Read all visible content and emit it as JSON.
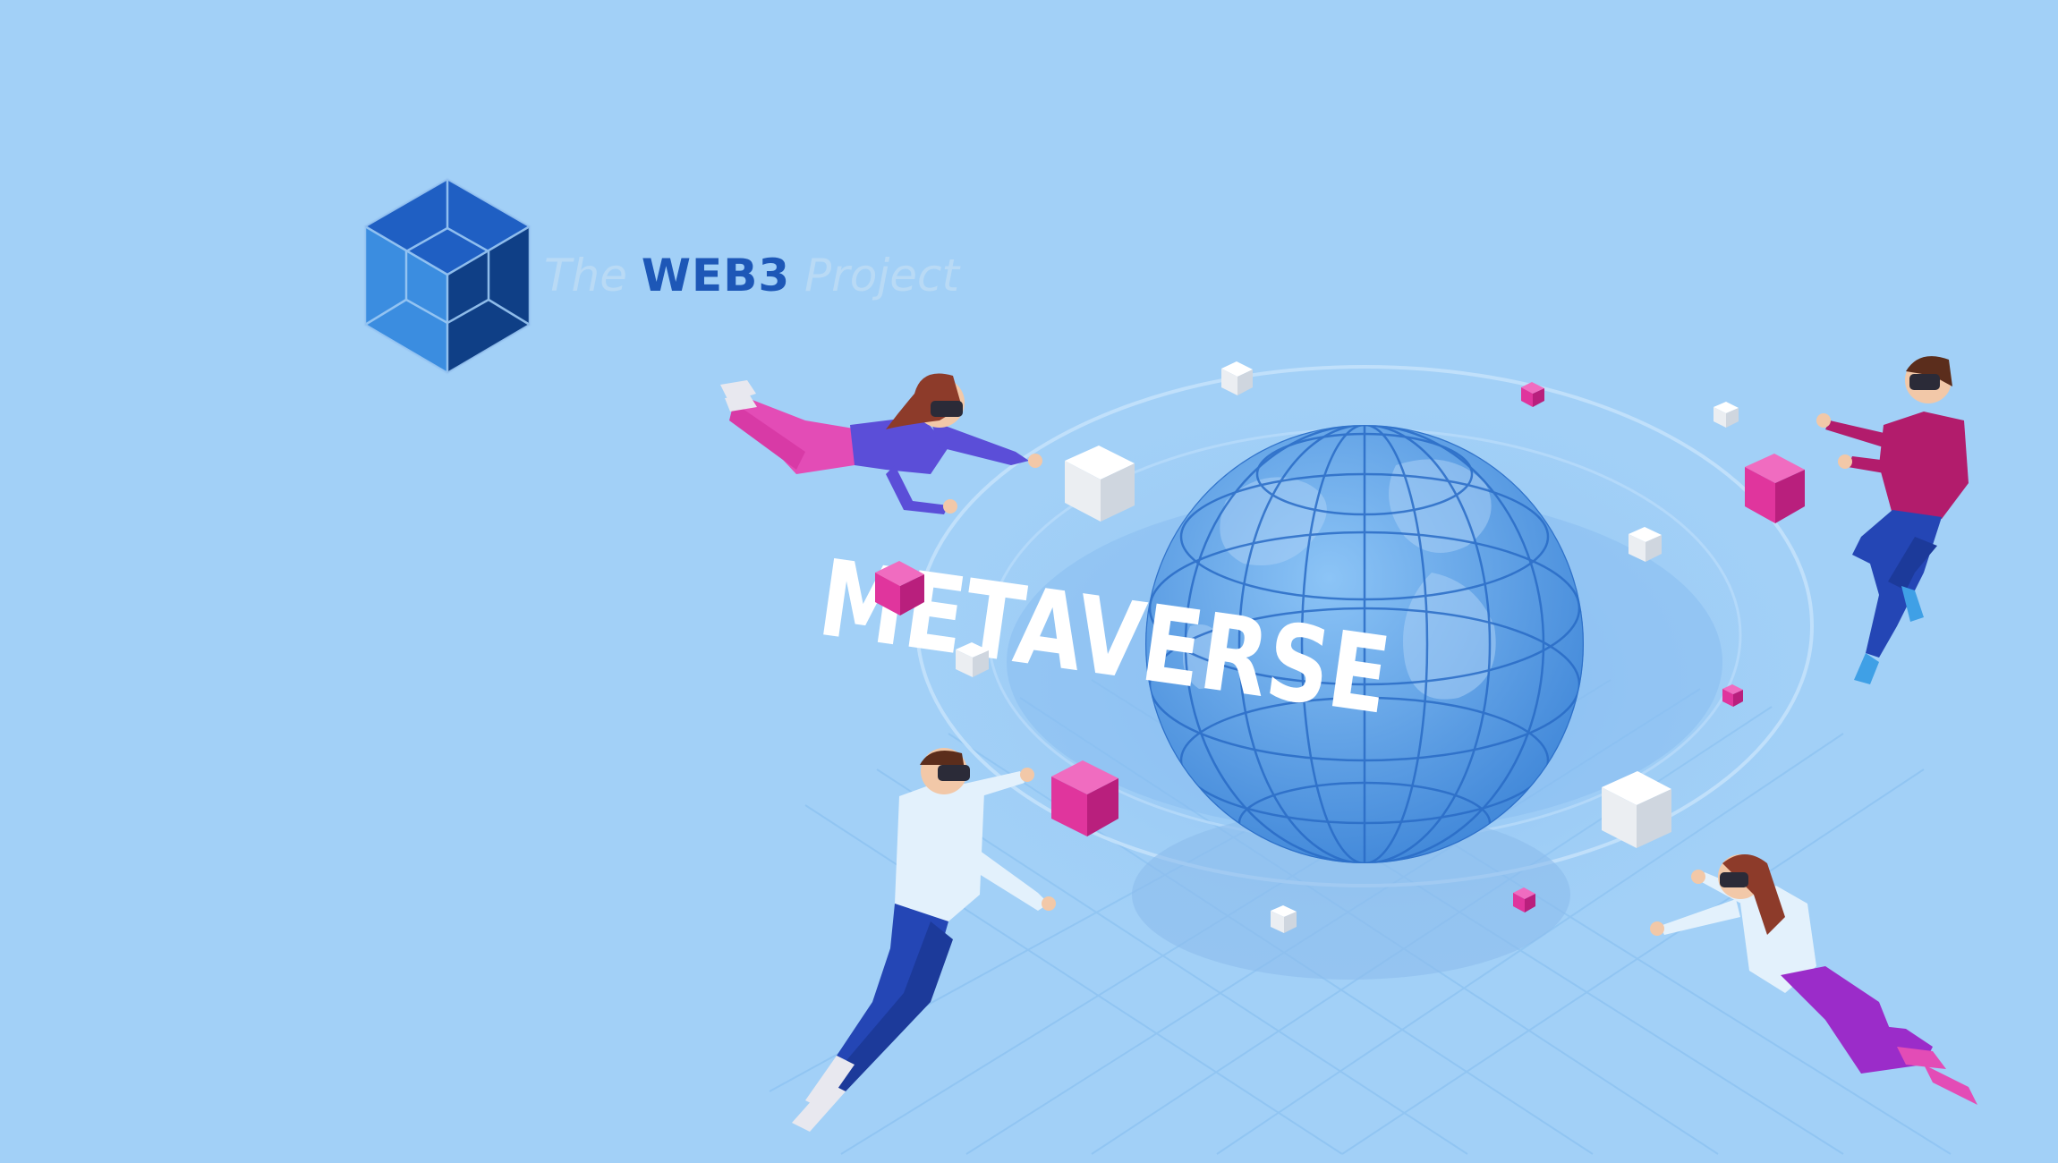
{
  "image": {
    "background_color": "#a2d0f7",
    "description_free": true
  },
  "logo": {
    "prefix": "The",
    "name": "WEB3",
    "suffix": "Project",
    "mark_icon": "hexagon-cube-logo-icon",
    "colors": {
      "dark": "#0f3f86",
      "mid": "#1d57b7",
      "light": "#3b8de0",
      "faded_text": "#b9daf5"
    }
  },
  "globe": {
    "label": "METAVERSE",
    "colors": {
      "sphere": "#5d9de6",
      "ring": "#8cc0f3",
      "text": "#ffffff"
    }
  },
  "cube_colors": {
    "pink": "#e0359d",
    "white": "#f2f2f2"
  }
}
